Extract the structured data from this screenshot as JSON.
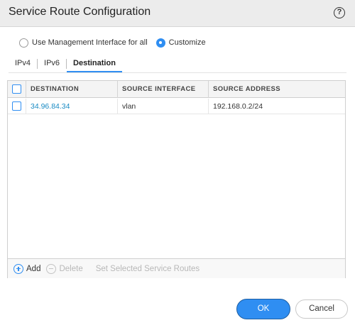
{
  "dialog": {
    "title": "Service Route Configuration",
    "help_label": "?"
  },
  "mode": {
    "options": [
      {
        "label": "Use Management Interface for all",
        "selected": false
      },
      {
        "label": "Customize",
        "selected": true
      }
    ]
  },
  "tabs": [
    {
      "label": "IPv4",
      "active": false
    },
    {
      "label": "IPv6",
      "active": false
    },
    {
      "label": "Destination",
      "active": true
    }
  ],
  "table": {
    "columns": [
      "DESTINATION",
      "SOURCE INTERFACE",
      "SOURCE ADDRESS"
    ],
    "rows": [
      {
        "destination": "34.96.84.34",
        "source_interface": "vlan",
        "source_address": "192.168.0.2/24"
      }
    ]
  },
  "toolbar": {
    "add_label": "Add",
    "delete_label": "Delete",
    "set_selected_label": "Set Selected Service Routes"
  },
  "buttons": {
    "ok_label": "OK",
    "cancel_label": "Cancel"
  },
  "colors": {
    "accent": "#2f8ef2",
    "link": "#1a8bc4",
    "disabled_text": "#b8b8b8"
  }
}
